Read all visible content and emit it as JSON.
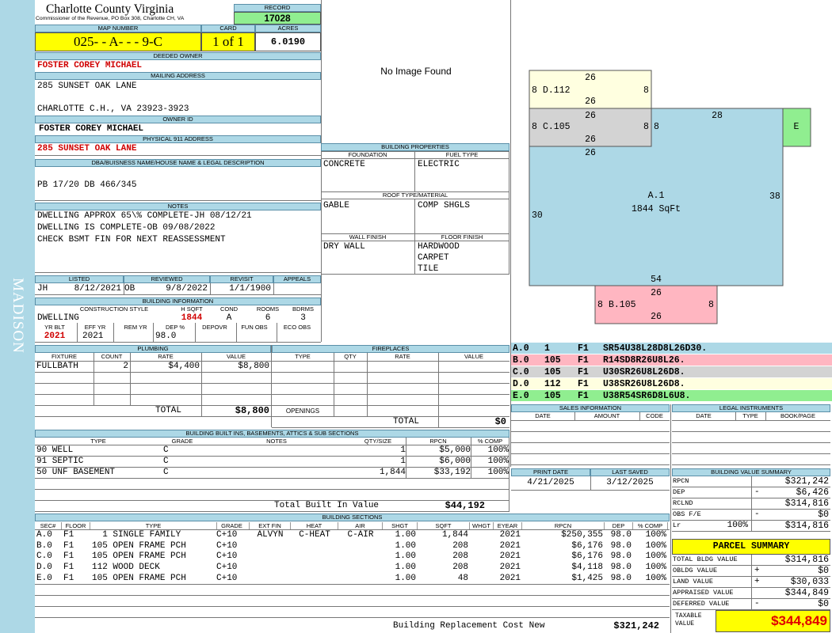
{
  "district": "MADISON",
  "county": {
    "name": "Charlotte County Virginia",
    "commissioner": "Commissioner of the Revenue, PO Box 308, Charlotte CH, VA"
  },
  "record": {
    "label": "RECORD",
    "value": "17028"
  },
  "map": {
    "label": "MAP NUMBER",
    "value": "025- - A- - - 9-C"
  },
  "card": {
    "label": "CARD",
    "value": "1 of 1"
  },
  "acres": {
    "label": "ACRES",
    "value": "6.0190"
  },
  "owner": {
    "deeded_label": "DEEDED OWNER",
    "deeded": "FOSTER COREY MICHAEL",
    "mailing_label": "MAILING ADDRESS",
    "mailing_line1": "285 SUNSET OAK LANE",
    "mailing_line2": "CHARLOTTE C.H., VA 23923-3923",
    "id_label": "OWNER ID",
    "id": "FOSTER COREY MICHAEL",
    "addr_label": "PHYSICAL 911 ADDRESS",
    "addr": "285 SUNSET OAK LANE"
  },
  "dba": {
    "label": "DBA/BUISNESS NAME/HOUSE NAME & LEGAL DESCRIPTION",
    "value": "PB 17/20 DB 466/345"
  },
  "notes": {
    "label": "NOTES",
    "lines": [
      "DWELLING APPROX 65\\% COMPLETE-JH 08/12/21",
      "DWELLING IS COMPLETE-OB 09/08/2022",
      "CHECK BSMT FIN FOR NEXT REASSESSMENT"
    ]
  },
  "dates": {
    "listed_label": "LISTED",
    "listed_by": "JH",
    "listed": "8/12/2021",
    "reviewed_label": "REVIEWED",
    "reviewed_by": "OB",
    "reviewed": "9/8/2022",
    "revisit_label": "REVISIT",
    "revisit": "1/1/1900",
    "appeals_label": "APPEALS"
  },
  "bldg_info": {
    "label": "BUILDING INFORMATION",
    "cs_label": "CONSTRUCTION STYLE",
    "cs": "DWELLING",
    "hsqft_label": "H SQFT",
    "hsqft": "1844",
    "cond_label": "COND",
    "cond": "A",
    "rooms_label": "ROOMS",
    "rooms": "6",
    "bdrms_label": "BDRMS",
    "bdrms": "3",
    "yrblt_label": "YR BLT",
    "yrblt": "2021",
    "effyr_label": "EFF YR",
    "effyr": "2021",
    "remyr_label": "REM YR",
    "dep_label": "DEP %",
    "dep": "98.0",
    "depovr_label": "DEPOVR",
    "funobs_label": "FUN OBS",
    "ecoobs_label": "ECO OBS"
  },
  "image": {
    "text": "No Image Found"
  },
  "bprops": {
    "label": "BUILDING PROPERTIES",
    "found_label": "FOUNDATION",
    "found": "CONCRETE",
    "fuel_label": "FUEL TYPE",
    "fuel": "ELECTRIC",
    "roof_label": "ROOF TYPE/MATERIAL",
    "roof1": "GABLE",
    "roof2": "COMP SHGLS",
    "wall_label": "WALL FINISH",
    "wall": "DRY WALL",
    "floor_label": "FLOOR FINISH",
    "floor1": "HARDWOOD",
    "floor2": "CARPET",
    "floor3": "TILE"
  },
  "sketch": {
    "a_name": "A.1",
    "a_area": "1844 SqFt",
    "a_top": "28",
    "a_left": "30",
    "a_right": "38",
    "a_bottom": "54",
    "b_name": "B.105",
    "b_top": "26",
    "b_bottom": "26",
    "b_left": "8",
    "b_right": "8",
    "c_name": "C.105",
    "c_top": "26",
    "c_bottom": "26",
    "c_left": "8",
    "c_right": "8",
    "d_name": "D.112",
    "d_top": "26",
    "d_bottom": "26",
    "d_left": "8",
    "d_right": "8",
    "e_name": "E",
    "extra_8": "8",
    "extra_26": "26",
    "colors": {
      "a": "#add8e6",
      "b": "#ffb6c1",
      "c": "#d3d3d3",
      "d": "#ffffe0",
      "e": "#90ee90"
    }
  },
  "sketch_codes": [
    {
      "sec": "A.0",
      "n": "1",
      "f": "F1",
      "code": "SR54U38L28D8L26D30.",
      "color": "#add8e6"
    },
    {
      "sec": "B.0",
      "n": "105",
      "f": "F1",
      "code": "R14SD8R26U8L26.",
      "color": "#ffb6c1"
    },
    {
      "sec": "C.0",
      "n": "105",
      "f": "F1",
      "code": "U30SR26U8L26D8.",
      "color": "#d3d3d3"
    },
    {
      "sec": "D.0",
      "n": "112",
      "f": "F1",
      "code": "U38SR26U8L26D8.",
      "color": "#ffffe0"
    },
    {
      "sec": "E.0",
      "n": "105",
      "f": "F1",
      "code": "U38R54SR6D8L6U8.",
      "color": "#90ee90"
    }
  ],
  "plumbing": {
    "label": "PLUMBING",
    "h_fixture": "FIXTURE",
    "h_count": "COUNT",
    "h_rate": "RATE",
    "h_value": "VALUE",
    "rows": [
      {
        "fixture": "FULLBATH",
        "count": "2",
        "rate": "$4,400",
        "value": "$8,800"
      }
    ],
    "total_label": "TOTAL",
    "total": "$8,800"
  },
  "fireplaces": {
    "label": "FIREPLACES",
    "h_type": "TYPE",
    "h_qty": "QTY",
    "h_rate": "RATE",
    "h_value": "VALUE",
    "openings_label": "OPENINGS",
    "total_label": "TOTAL",
    "total": "$0"
  },
  "sales": {
    "label": "SALES INFORMATION",
    "h_date": "DATE",
    "h_amount": "AMOUNT",
    "h_code": "CODE"
  },
  "legal": {
    "label": "LEGAL INSTRUMENTS",
    "h_date": "DATE",
    "h_type": "TYPE",
    "h_book": "BOOK/PAGE"
  },
  "builtins": {
    "label": "BUILDING BUILT INS, BASEMENTS, ATTICS & SUB SECTIONS",
    "h_type": "TYPE",
    "h_grade": "GRADE",
    "h_notes": "NOTES",
    "h_qty": "QTY/SIZE",
    "h_rpcn": "RPCN",
    "h_comp": "% COMP",
    "rows": [
      {
        "type": "90 WELL",
        "grade": "C",
        "qty": "1",
        "rpcn": "$5,000",
        "comp": "100%"
      },
      {
        "type": "91 SEPTIC",
        "grade": "C",
        "qty": "1",
        "rpcn": "$6,000",
        "comp": "100%"
      },
      {
        "type": "50 UNF BASEMENT",
        "grade": "C",
        "qty": "1,844",
        "rpcn": "$33,192",
        "comp": "100%"
      }
    ],
    "total_label": "Total Built In Value",
    "total": "$44,192"
  },
  "print": {
    "print_label": "PRINT DATE",
    "print": "4/21/2025",
    "saved_label": "LAST SAVED",
    "saved": "3/12/2025"
  },
  "bvs": {
    "label": "BUILDING VALUE SUMMARY",
    "rows": [
      {
        "k": "RPCN",
        "s": "",
        "v": "$321,242"
      },
      {
        "k": "DEP",
        "s": "-",
        "v": "$6,426"
      },
      {
        "k": "RCLND",
        "s": "",
        "v": "$314,816"
      },
      {
        "k": "OBS F/E",
        "s": "-",
        "v": "$0"
      },
      {
        "k": "Lr",
        "s": "100%",
        "v": "$314,816"
      }
    ]
  },
  "parcel": {
    "label": "PARCEL SUMMARY",
    "rows": [
      {
        "k": "TOTAL BLDG VALUE",
        "s": "",
        "v": "$314,816"
      },
      {
        "k": "OBLDG VALUE",
        "s": "+",
        "v": "$0"
      },
      {
        "k": "LAND VALUE",
        "s": "+",
        "v": "$30,033"
      },
      {
        "k": "APPRAISED VALUE",
        "s": "",
        "v": "$344,849"
      },
      {
        "k": "DEFERRED VALUE",
        "s": "-",
        "v": "$0"
      }
    ],
    "taxable_label": "TAXABLE VALUE",
    "taxable": "$344,849"
  },
  "sections": {
    "label": "BUILDING SECTIONS",
    "h": [
      "SEC#",
      "FLOOR",
      "TYPE",
      "GRADE",
      "EXT FIN",
      "HEAT",
      "AIR",
      "SHGT",
      "SQFT",
      "WHGT",
      "EYEAR",
      "RPCN",
      "DEP",
      "% COMP"
    ],
    "rows": [
      {
        "sec": "A.0",
        "floor": "F1",
        "type": "1 SINGLE FAMILY",
        "grade": "C+10",
        "ext": "ALVYN",
        "heat": "C-HEAT",
        "air": "C-AIR",
        "shgt": "1.00",
        "sqft": "1,844",
        "eyear": "2021",
        "rpcn": "$250,355",
        "dep": "98.0",
        "comp": "100%"
      },
      {
        "sec": "B.0",
        "floor": "F1",
        "type": "105 OPEN FRAME PCH",
        "grade": "C+10",
        "ext": "",
        "heat": "",
        "air": "",
        "shgt": "1.00",
        "sqft": "208",
        "eyear": "2021",
        "rpcn": "$6,176",
        "dep": "98.0",
        "comp": "100%"
      },
      {
        "sec": "C.0",
        "floor": "F1",
        "type": "105 OPEN FRAME PCH",
        "grade": "C+10",
        "ext": "",
        "heat": "",
        "air": "",
        "shgt": "1.00",
        "sqft": "208",
        "eyear": "2021",
        "rpcn": "$6,176",
        "dep": "98.0",
        "comp": "100%"
      },
      {
        "sec": "D.0",
        "floor": "F1",
        "type": "112 WOOD DECK",
        "grade": "C+10",
        "ext": "",
        "heat": "",
        "air": "",
        "shgt": "1.00",
        "sqft": "208",
        "eyear": "2021",
        "rpcn": "$4,118",
        "dep": "98.0",
        "comp": "100%"
      },
      {
        "sec": "E.0",
        "floor": "F1",
        "type": "105 OPEN FRAME PCH",
        "grade": "C+10",
        "ext": "",
        "heat": "",
        "air": "",
        "shgt": "1.00",
        "sqft": "48",
        "eyear": "2021",
        "rpcn": "$1,425",
        "dep": "98.0",
        "comp": "100%"
      }
    ],
    "total_label": "Building Replacement Cost New",
    "total": "$321,242"
  }
}
